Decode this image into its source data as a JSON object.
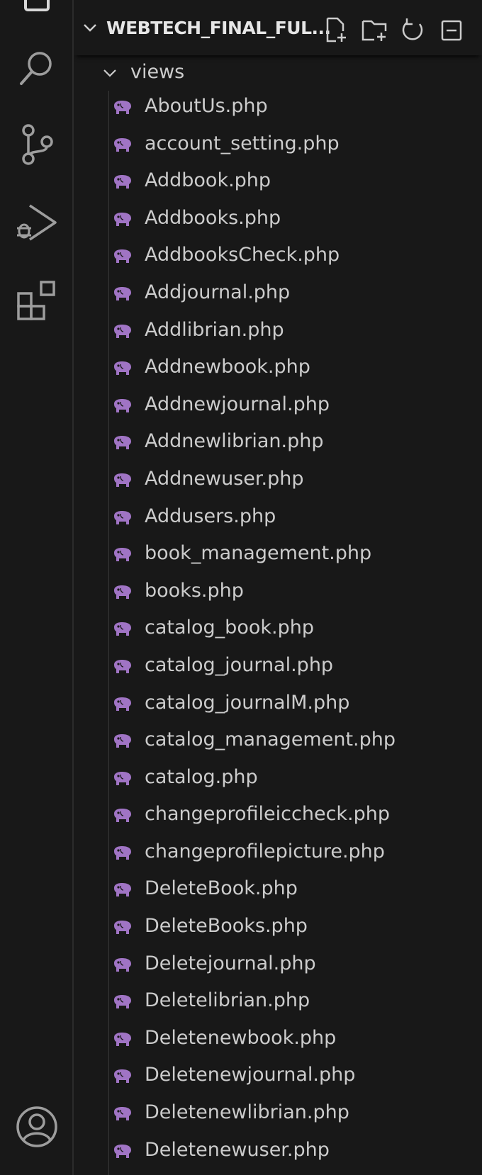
{
  "explorer": {
    "title": "WEBTECH_FINAL_FUL...",
    "actions": [
      "new-file-icon",
      "new-folder-icon",
      "refresh-icon",
      "collapse-all-icon"
    ]
  },
  "activity_bar": {
    "items": [
      "search-icon",
      "source-control-icon",
      "run-debug-icon",
      "extensions-icon",
      "account-icon"
    ]
  },
  "colors": {
    "background": "#181818",
    "php_icon": "#a074c4",
    "text": "#cccccc"
  },
  "tree": {
    "folder": "views",
    "files": [
      "AboutUs.php",
      "account_setting.php",
      "Addbook.php",
      "Addbooks.php",
      "AddbooksCheck.php",
      "Addjournal.php",
      "Addlibrian.php",
      "Addnewbook.php",
      "Addnewjournal.php",
      "Addnewlibrian.php",
      "Addnewuser.php",
      "Addusers.php",
      "book_management.php",
      "books.php",
      "catalog_book.php",
      "catalog_journal.php",
      "catalog_journalM.php",
      "catalog_management.php",
      "catalog.php",
      "changeprofileiccheck.php",
      "changeprofilepicture.php",
      "DeleteBook.php",
      "DeleteBooks.php",
      "Deletejournal.php",
      "Deletelibrian.php",
      "Deletenewbook.php",
      "Deletenewjournal.php",
      "Deletenewlibrian.php",
      "Deletenewuser.php"
    ]
  }
}
